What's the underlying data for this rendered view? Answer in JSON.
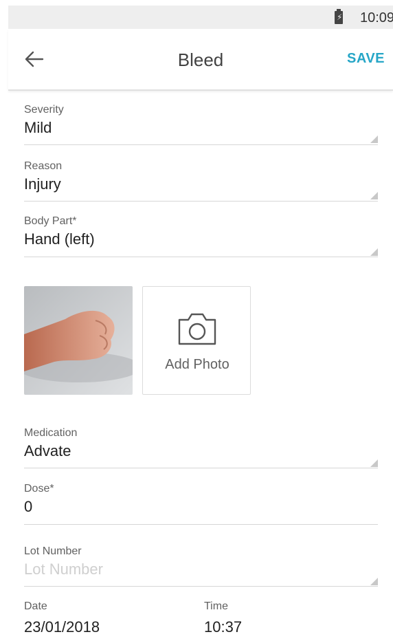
{
  "status_bar": {
    "time": "10:09",
    "battery_icon": "battery-charging-icon"
  },
  "app_bar": {
    "title": "Bleed",
    "save_label": "SAVE",
    "back_icon": "arrow-left-icon",
    "accent": "#26a6c7"
  },
  "fields": {
    "severity": {
      "label": "Severity",
      "value": "Mild"
    },
    "reason": {
      "label": "Reason",
      "value": "Injury"
    },
    "body_part": {
      "label": "Body Part*",
      "value": "Hand (left)"
    },
    "medication": {
      "label": "Medication",
      "value": "Advate"
    },
    "dose": {
      "label": "Dose*",
      "value": "0"
    },
    "lot_number": {
      "label": "Lot Number",
      "placeholder": "Lot Number"
    },
    "date": {
      "label": "Date",
      "value": "23/01/2018"
    },
    "time": {
      "label": "Time",
      "value": "10:37"
    }
  },
  "photos": {
    "add_label": "Add Photo",
    "camera_icon": "camera-icon"
  }
}
